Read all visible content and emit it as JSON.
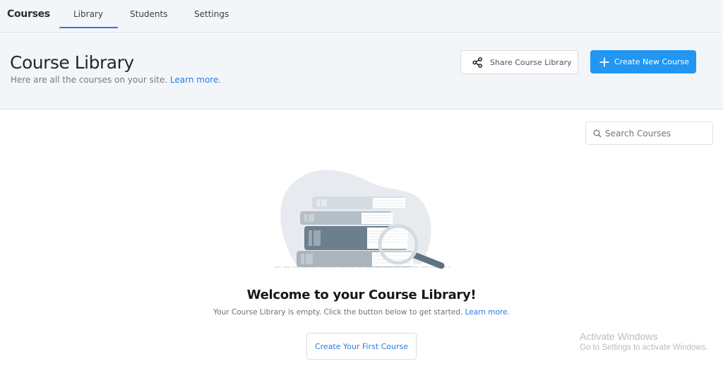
{
  "nav": {
    "brand": "Courses",
    "tabs": [
      {
        "label": "Library",
        "active": true
      },
      {
        "label": "Students",
        "active": false
      },
      {
        "label": "Settings",
        "active": false
      }
    ]
  },
  "header": {
    "title": "Course Library",
    "subtitle": "Here are all the courses on your site.",
    "subtitle_link": "Learn more.",
    "share_button": {
      "label": "Share Course Library",
      "icon": "share-icon"
    },
    "create_button": {
      "label": "Create New Course",
      "icon": "plus-icon"
    }
  },
  "search": {
    "placeholder": "Search Courses",
    "value": "",
    "icon": "search-icon"
  },
  "empty_state": {
    "illustration": "books-with-magnifier",
    "title": "Welcome to your Course Library!",
    "text": "Your Course Library is empty. Click the button below to get started.",
    "link": "Learn more.",
    "button_label": "Create Your First Course"
  },
  "watermark": {
    "title": "Activate Windows",
    "subtitle": "Go to Settings to activate Windows."
  },
  "colors": {
    "accent": "#2196f3",
    "link": "#2a7ae2",
    "header_bg": "#f3f6f9"
  }
}
